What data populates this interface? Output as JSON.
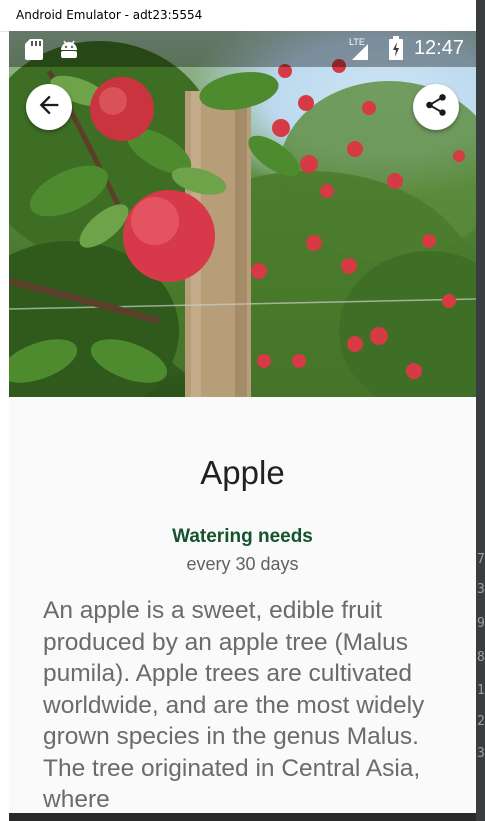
{
  "window": {
    "title": "Android Emulator - adt23:5554"
  },
  "status_bar": {
    "time": "12:47",
    "network_label": "LTE"
  },
  "toolbar": {
    "back_icon": "arrow-back-icon",
    "share_icon": "share-icon"
  },
  "plant": {
    "name": "Apple",
    "watering_label": "Watering needs",
    "watering_value": "every 30 days",
    "description": "An apple is a sweet, edible fruit produced by an apple tree (Malus pumila). Apple trees are cultivated worldwide, and are the most widely grown species in the genus Malus. The tree originated in Central Asia, where"
  },
  "colors": {
    "accent_green": "#14532d",
    "title_text": "#212121",
    "body_text": "#6b6b6b"
  }
}
